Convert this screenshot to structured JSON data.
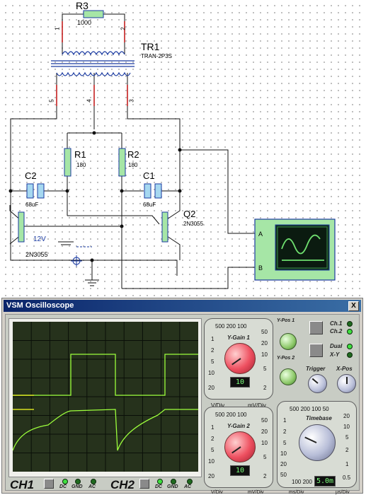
{
  "schematic": {
    "r3": {
      "ref": "R3",
      "value": "1000",
      "pin1": "1",
      "pin2": "2"
    },
    "tr1": {
      "ref": "TR1",
      "type": "TRAN-2P3S",
      "pin5": "5",
      "pin4": "4",
      "pin3": "3"
    },
    "r1": {
      "ref": "R1",
      "value": "180"
    },
    "r2": {
      "ref": "R2",
      "value": "180"
    },
    "c2": {
      "ref": "C2",
      "value": "68uF"
    },
    "c1": {
      "ref": "C1",
      "value": "68uF"
    },
    "q2": {
      "ref": "Q2",
      "type": "2N3055"
    },
    "q1": {
      "type": "2N3055"
    },
    "battery": {
      "value": "12V"
    },
    "scope_in_a": "A",
    "scope_in_b": "B"
  },
  "oscilloscope": {
    "title": "VSM Oscilloscope",
    "close_glyph": "X",
    "ch1_label": "CH1",
    "ch2_label": "CH2",
    "coupling": {
      "dc": "DC",
      "gnd": "GND",
      "ac": "AC"
    },
    "channel_labels": {
      "ch1": "Ch.1",
      "ch2": "Ch.2",
      "dual": "Dual",
      "xy": "X-Y"
    },
    "ygain1": {
      "title": "Y-Gain 1",
      "scale_top": "500 200 100",
      "left_ticks": [
        "1",
        "2",
        "5",
        "10",
        "20"
      ],
      "right_ticks": [
        "50",
        "20",
        "10",
        "5",
        "2"
      ],
      "v_unit": "V/Div",
      "mv_unit": "mV/Div",
      "display": "10"
    },
    "ygain2": {
      "title": "Y-Gain 2",
      "scale_top": "500 200 100",
      "left_ticks": [
        "1",
        "2",
        "5",
        "10",
        "20"
      ],
      "right_ticks": [
        "50",
        "20",
        "10",
        "5",
        "2"
      ],
      "v_unit": "V/Div",
      "mv_unit": "mV/Div",
      "display": "10"
    },
    "ypos1": "Y-Pos 1",
    "ypos2": "Y-Pos 2",
    "trigger": "Trigger",
    "xpos": "X-Pos",
    "timebase": {
      "title": "Timebase",
      "scale_top": "500 200 100 50",
      "left_ticks": [
        "1",
        "2",
        "5",
        "10",
        "20",
        "50"
      ],
      "right_ticks": [
        "20",
        "10",
        "5",
        "2",
        "1",
        "0.5"
      ],
      "bottom_left": "100 200",
      "ms_unit": "ms/Div",
      "us_unit": "µs/Div",
      "display": "5.0m"
    },
    "colors": {
      "trace": "#9cff3c",
      "screen": "#26321c",
      "grid": "#0a0f08"
    }
  }
}
